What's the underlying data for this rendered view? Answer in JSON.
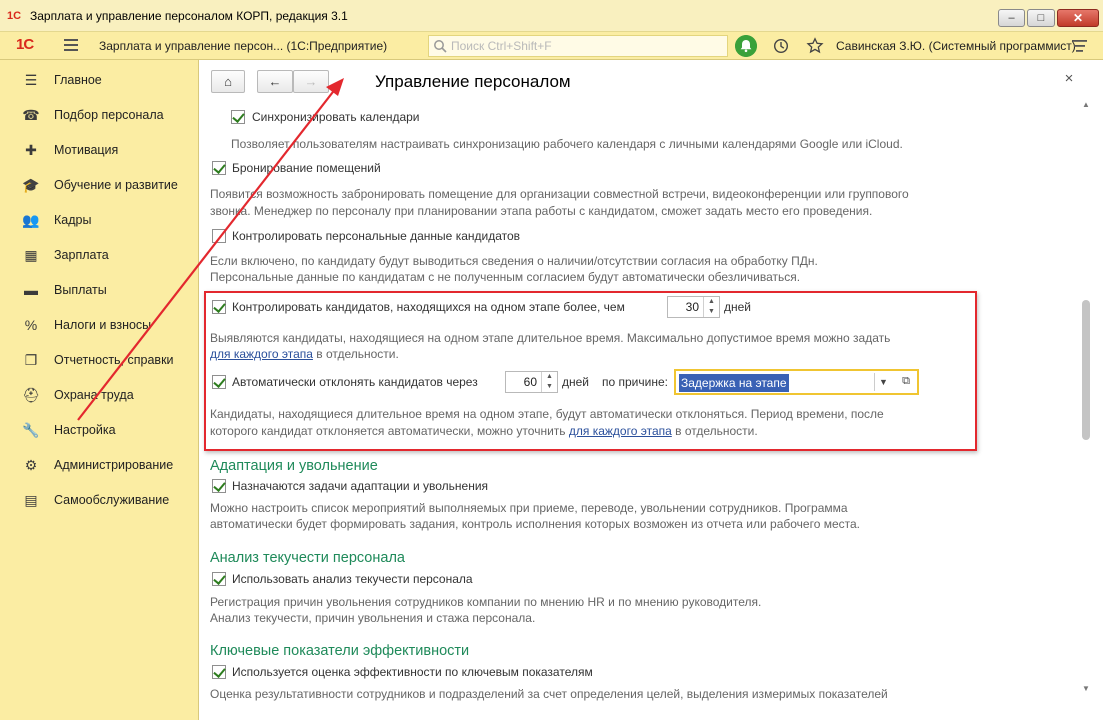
{
  "window": {
    "title": "Зарплата и управление персоналом КОРП, редакция 3.1",
    "logo_text": "1С",
    "minimize_glyph": "–",
    "maximize_glyph": "□",
    "close_glyph": "✕"
  },
  "appbar": {
    "logo": "1С",
    "configuration": "Зарплата и управление персон...  (1С:Предприятие)",
    "search_placeholder": "Поиск Ctrl+Shift+F",
    "user": "Савинская З.Ю. (Системный программист)"
  },
  "sidebar": {
    "items": [
      {
        "label": "Главное",
        "icon": "☰",
        "icon_name": "menu-list-icon"
      },
      {
        "label": "Подбор персонала",
        "icon": "☎",
        "icon_name": "phone-icon"
      },
      {
        "label": "Мотивация",
        "icon": "✚",
        "icon_name": "gift-icon"
      },
      {
        "label": "Обучение и развитие",
        "icon": "🎓",
        "icon_name": "graduation-cap-icon"
      },
      {
        "label": "Кадры",
        "icon": "👥",
        "icon_name": "people-icon"
      },
      {
        "label": "Зарплата",
        "icon": "▦",
        "icon_name": "calculator-icon"
      },
      {
        "label": "Выплаты",
        "icon": "▬",
        "icon_name": "wallet-icon"
      },
      {
        "label": "Налоги и взносы",
        "icon": "%",
        "icon_name": "percent-icon"
      },
      {
        "label": "Отчетность, справки",
        "icon": "❐",
        "icon_name": "reports-icon"
      },
      {
        "label": "Охрана труда",
        "icon": "⛑",
        "icon_name": "helmet-icon"
      },
      {
        "label": "Настройка",
        "icon": "🔧",
        "icon_name": "wrench-icon"
      },
      {
        "label": "Администрирование",
        "icon": "⚙",
        "icon_name": "gear-icon"
      },
      {
        "label": "Самообслуживание",
        "icon": "▤",
        "icon_name": "id-card-icon"
      }
    ]
  },
  "main": {
    "title": "Управление персоналом",
    "home_glyph": "⌂",
    "back_glyph": "←",
    "fwd_glyph": "→",
    "close_glyph": "×",
    "sync_calendars": {
      "label": "Синхронизировать календари",
      "checked": true,
      "desc": "Позволяет пользователям настраивать синхронизацию рабочего календаря с личными календарями Google или iCloud."
    },
    "room_booking": {
      "label": "Бронирование помещений",
      "checked": true,
      "desc1": "Появится возможность забронировать помещение для организации совместной встречи, видеоконференции или группового",
      "desc2": "звонка. Менеджер по персоналу при планировании этапа работы с кандидатом, сможет задать место его проведения."
    },
    "pd_control": {
      "label": "Контролировать персональные данные кандидатов",
      "checked": false,
      "desc1": "Если включено, по кандидату будут выводиться сведения о наличии/отсутствии согласия на обработку ПДн.",
      "desc2": "Персональные данные по кандидатам с не полученным согласием будут автоматически обезличиваться."
    },
    "stage_control": {
      "label": "Контролировать кандидатов, находящихся на одном этапе более, чем",
      "checked": true,
      "days_value": "30",
      "days_label": "дней",
      "desc1": "Выявляются кандидаты, находящиеся на одном этапе длительное время. Максимально допустимое время можно задать",
      "desc2_link": "для каждого этапа",
      "desc2_rest": " в отдельности."
    },
    "auto_reject": {
      "label": "Автоматически отклонять кандидатов через",
      "checked": true,
      "days_value": "60",
      "days_label": "дней",
      "reason_label": "по причине:",
      "reason_value": "Задержка на этапе",
      "desc1": "Кандидаты, находящиеся длительное время на одном этапе, будут автоматически отклоняться. Период времени, после",
      "desc2_pre": "которого кандидат отклоняется автоматически, можно уточнить ",
      "desc2_link": "для каждого этапа",
      "desc2_rest": " в отдельности."
    },
    "adaptation": {
      "section": "Адаптация и увольнение",
      "label": "Назначаются задачи адаптации и увольнения",
      "checked": true,
      "desc1": "Можно настроить список мероприятий выполняемых при приеме, переводе, увольнении сотрудников. Программа",
      "desc2": "автоматически будет формировать задания, контроль исполнения которых возможен из отчета или рабочего места."
    },
    "turnover": {
      "section": "Анализ текучести персонала",
      "label": "Использовать анализ текучести персонала",
      "checked": true,
      "desc1": "Регистрация причин увольнения сотрудников компании по мнению HR и по мнению руководителя.",
      "desc2": "Анализ текучести, причин увольнения и стажа персонала."
    },
    "kpi": {
      "section": "Ключевые показатели эффективности",
      "label": "Используется оценка эффективности по ключевым показателям",
      "checked": true,
      "desc1": "Оценка результативности сотрудников и подразделений за счет определения целей,  выделения измеримых показателей"
    }
  },
  "colors": {
    "accent_yellow": "#fbeda3",
    "highlight_red": "#e3282e",
    "section_green": "#1f8a5a",
    "link_blue": "#2a4f9b",
    "selection_blue": "#3961b5"
  }
}
